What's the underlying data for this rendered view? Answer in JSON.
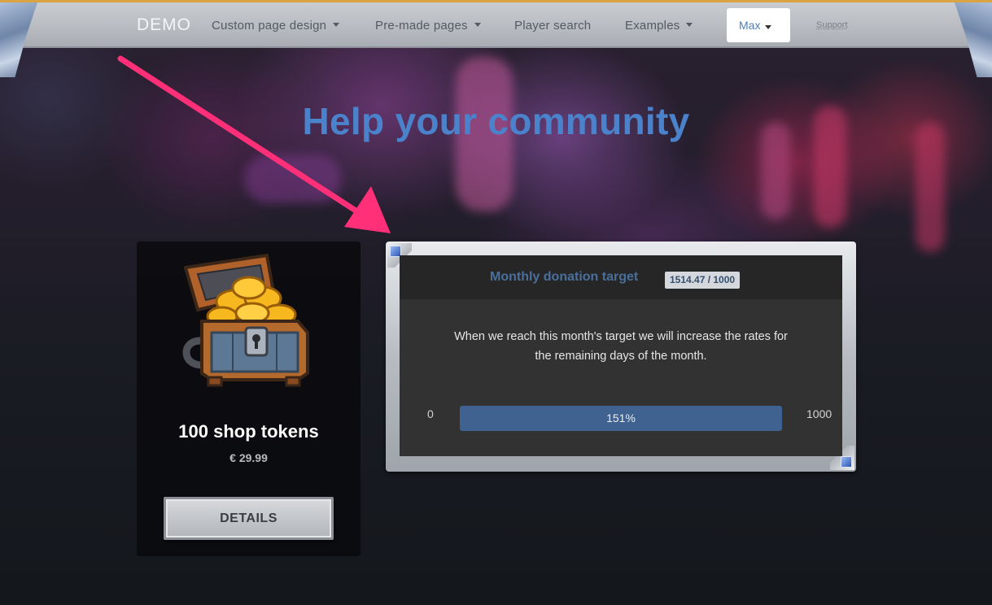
{
  "nav": {
    "brand": "DEMO",
    "items": [
      {
        "label": "Custom page design",
        "dropdown": true
      },
      {
        "label": "Pre-made pages",
        "dropdown": true
      },
      {
        "label": "Player search",
        "dropdown": false
      },
      {
        "label": "Examples",
        "dropdown": true
      }
    ],
    "user": {
      "label": "Max"
    },
    "support": "Support"
  },
  "hero": {
    "title": "Help your community"
  },
  "product": {
    "name": "100 shop tokens",
    "price": "€ 29.99",
    "button": "DETAILS",
    "icon": "treasure-chest-icon"
  },
  "donation": {
    "title": "Monthly donation target",
    "badge": "1514.47 / 1000",
    "description": "When we reach this month's target we will increase the rates for the remaining days of the month.",
    "min": "0",
    "max": "1000",
    "progress_label": "151%",
    "progress_fraction": 1.0
  },
  "colors": {
    "accent": "#4a83cc",
    "progress": "#3f6290",
    "annotation_arrow": "#ff2f78"
  }
}
